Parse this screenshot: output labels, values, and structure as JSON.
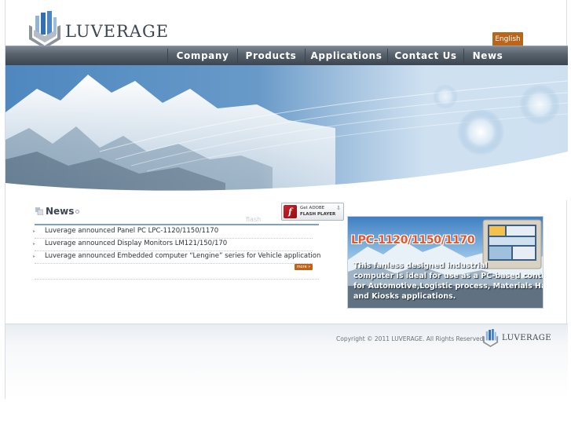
{
  "brand": {
    "name": "LUVERAGE",
    "accent": "#b9651b",
    "nav_bg": "#56606b",
    "title_color": "#e2582c"
  },
  "header": {
    "language_button": "English"
  },
  "nav": {
    "items": [
      {
        "label": "Company"
      },
      {
        "label": "Products"
      },
      {
        "label": "Applications"
      },
      {
        "label": "Contact Us"
      },
      {
        "label": "News"
      }
    ]
  },
  "news": {
    "title": "News",
    "flash_label": "flash",
    "flash_badge": {
      "line1": "Get ADOBE",
      "line2": "FLASH PLAYER",
      "icon": "flash-player-icon"
    },
    "items": [
      {
        "text": "Luverage announced Panel PC LPC-1120/1150/1170"
      },
      {
        "text": "Luverage announced Display Monitors LM121/150/170"
      },
      {
        "text": "Luverage announced Embedded computer “Lengine” series for Vehicle application"
      }
    ],
    "more_label": "more »"
  },
  "promo": {
    "title": "LPC-1120/1150/1170",
    "lines": [
      "This fanless designed industrial",
      "computer is ideal for use as a PC-based controller",
      "for Automotive,Logistic process, Materials Handling,",
      "and Kiosks applications."
    ]
  },
  "footer": {
    "copyright": "Copyright © 2011 LUVERAGE. All Rights Reserved"
  }
}
